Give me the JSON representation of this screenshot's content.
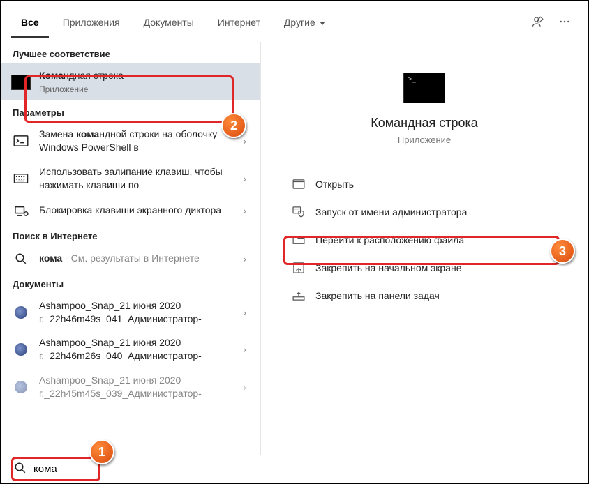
{
  "tabs": {
    "all": "Все",
    "apps": "Приложения",
    "docs": "Документы",
    "web": "Интернет",
    "more": "Другие"
  },
  "sections": {
    "best": "Лучшее соответствие",
    "settings": "Параметры",
    "websearch": "Поиск в Интернете",
    "documents": "Документы"
  },
  "bestMatch": {
    "prefix": "Кома",
    "rest": "ндная строка",
    "sub": "Приложение"
  },
  "settingsItems": [
    {
      "prefix": "Замена ",
      "bold": "кома",
      "rest": "ндной строки на оболочку Windows PowerShell в"
    },
    {
      "plain": "Использовать залипание клавиш, чтобы нажимать клавиши по"
    },
    {
      "plain": "Блокировка клавиши экранного диктора"
    }
  ],
  "webItem": {
    "bold": "кома",
    "hint": " - См. результаты в Интернете"
  },
  "docItems": [
    "Ashampoo_Snap_21 июня 2020 г._22h46m49s_041_Администратор-",
    "Ashampoo_Snap_21 июня 2020 г._22h46m26s_040_Администратор-",
    "Ashampoo_Snap_21 июня 2020 г._22h45m45s_039_Администратор-"
  ],
  "preview": {
    "title": "Командная строка",
    "sub": "Приложение"
  },
  "actions": {
    "open": "Открыть",
    "admin": "Запуск от имени администратора",
    "location": "Перейти к расположению файла",
    "pinstart": "Закрепить на начальном экране",
    "pintask": "Закрепить на панели задач"
  },
  "search": {
    "value": "кома"
  },
  "badges": {
    "b1": "1",
    "b2": "2",
    "b3": "3"
  }
}
